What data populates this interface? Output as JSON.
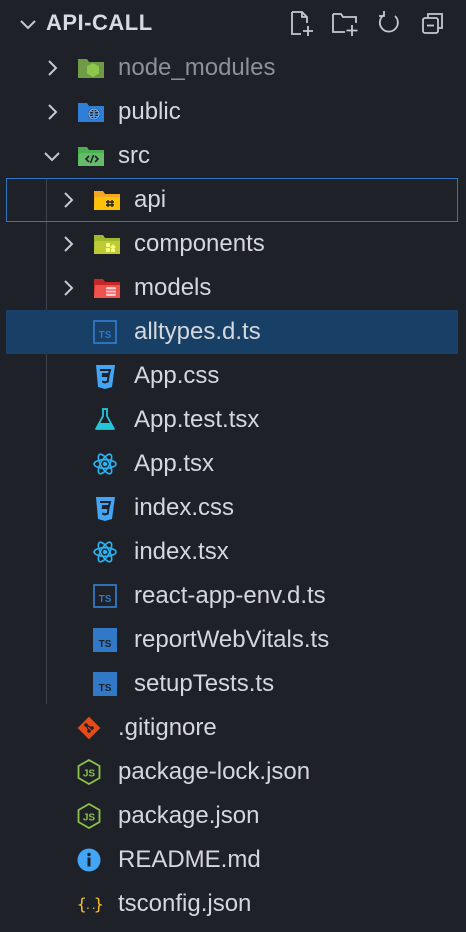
{
  "explorer": {
    "title": "API-CALL",
    "actions": [
      {
        "name": "new-file-icon"
      },
      {
        "name": "new-folder-icon"
      },
      {
        "name": "refresh-icon"
      },
      {
        "name": "collapse-all-icon"
      }
    ]
  },
  "tree": [
    {
      "label": "node_modules",
      "type": "folder",
      "icon": "node-folder-icon",
      "depth": 0,
      "expanded": false,
      "dim": true
    },
    {
      "label": "public",
      "type": "folder",
      "icon": "public-folder-icon",
      "depth": 0,
      "expanded": false
    },
    {
      "label": "src",
      "type": "folder",
      "icon": "src-folder-icon",
      "depth": 0,
      "expanded": true
    },
    {
      "label": "api",
      "type": "folder",
      "icon": "api-folder-icon",
      "depth": 1,
      "expanded": false,
      "focused": true
    },
    {
      "label": "components",
      "type": "folder",
      "icon": "components-folder-icon",
      "depth": 1,
      "expanded": false
    },
    {
      "label": "models",
      "type": "folder",
      "icon": "models-folder-icon",
      "depth": 1,
      "expanded": false
    },
    {
      "label": "alltypes.d.ts",
      "type": "file",
      "icon": "typescript-def-icon",
      "depth": 1,
      "selected": true
    },
    {
      "label": "App.css",
      "type": "file",
      "icon": "css-icon",
      "depth": 1
    },
    {
      "label": "App.test.tsx",
      "type": "file",
      "icon": "test-flask-icon",
      "depth": 1
    },
    {
      "label": "App.tsx",
      "type": "file",
      "icon": "react-icon",
      "depth": 1
    },
    {
      "label": "index.css",
      "type": "file",
      "icon": "css-icon",
      "depth": 1
    },
    {
      "label": "index.tsx",
      "type": "file",
      "icon": "react-icon",
      "depth": 1
    },
    {
      "label": "react-app-env.d.ts",
      "type": "file",
      "icon": "typescript-def-icon",
      "depth": 1
    },
    {
      "label": "reportWebVitals.ts",
      "type": "file",
      "icon": "typescript-icon",
      "depth": 1
    },
    {
      "label": "setupTests.ts",
      "type": "file",
      "icon": "typescript-icon",
      "depth": 1
    },
    {
      "label": ".gitignore",
      "type": "file",
      "icon": "git-icon",
      "depth": 0
    },
    {
      "label": "package-lock.json",
      "type": "file",
      "icon": "nodejs-icon",
      "depth": 0
    },
    {
      "label": "package.json",
      "type": "file",
      "icon": "nodejs-icon",
      "depth": 0
    },
    {
      "label": "README.md",
      "type": "file",
      "icon": "info-icon",
      "depth": 0
    },
    {
      "label": "tsconfig.json",
      "type": "file",
      "icon": "json-braces-icon",
      "depth": 0
    }
  ],
  "colors": {
    "background": "#1e2127",
    "selection": "#183f65",
    "focus_border": "#2f74c0",
    "text": "#d4d7dc",
    "dim_text": "#8b909a"
  }
}
